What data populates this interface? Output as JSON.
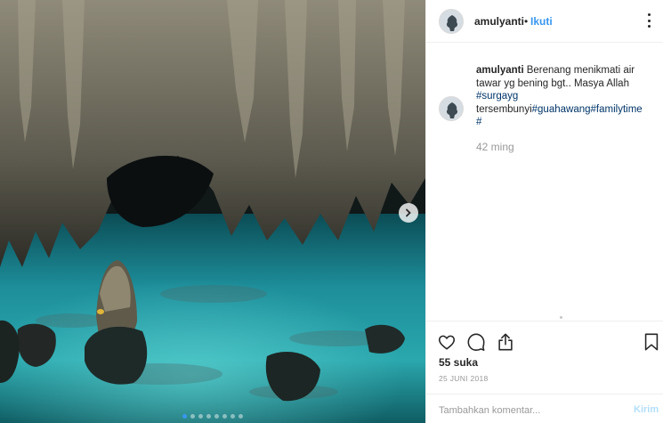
{
  "post": {
    "username": "amulyanti",
    "separator": "•",
    "follow_label": "Ikuti",
    "caption": {
      "username": "amulyanti",
      "text": "Berenang menikmati air tawar yg bening bgt.. Masya Allah ",
      "tag1": "#surgayg",
      "text2": "tersembunyi",
      "tag2": "#guahawang",
      "tag3": "#familytime",
      "tag4": "#"
    },
    "time_ago": "42 ming",
    "likes": "55 suka",
    "date": "25 JUNI 2018",
    "comment_placeholder": "Tambahkan komentar...",
    "post_label": "Kirim"
  },
  "carousel": {
    "slides": 8,
    "active": 1
  },
  "icons": {
    "like": "heart-icon",
    "comment": "comment-icon",
    "share": "share-icon",
    "save": "bookmark-icon",
    "more": "more-options-icon",
    "next": "chevron-right-icon"
  },
  "colors": {
    "link": "#3897f0",
    "hashtag": "#003569",
    "muted": "#999999",
    "post_disabled": "#b2dffc"
  }
}
